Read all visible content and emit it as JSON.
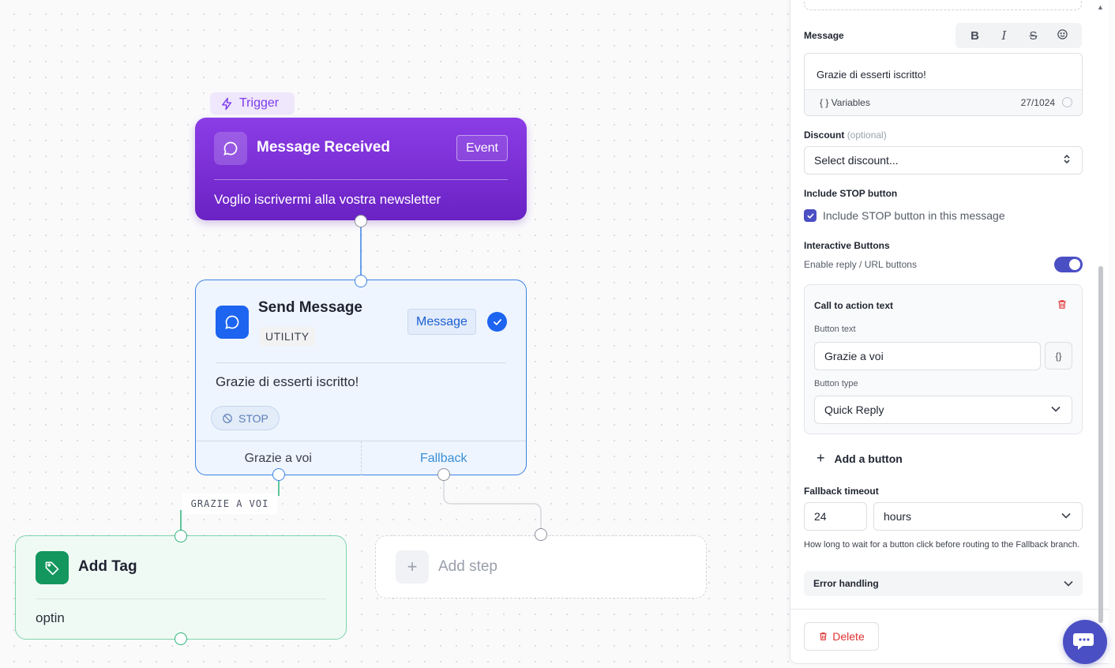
{
  "canvas": {
    "trigger_badge": "Trigger",
    "trigger_node": {
      "title": "Message Received",
      "tag": "Event",
      "body": "Voglio iscrivermi alla vostra newsletter"
    },
    "send_node": {
      "title": "Send Message",
      "category": "UTILITY",
      "tag": "Message",
      "body": "Grazie di esserti iscritto!",
      "stop_label": "STOP",
      "branches": [
        "Grazie a voi",
        "Fallback"
      ]
    },
    "edge_label": "GRAZIE A VOI",
    "tag_node": {
      "title": "Add Tag",
      "body": "optin"
    },
    "add_step": {
      "label": "Add step"
    }
  },
  "panel": {
    "message": {
      "label": "Message",
      "value": "Grazie di esserti iscritto!",
      "variables_label": "{ } Variables",
      "counter": "27/1024"
    },
    "discount": {
      "label": "Discount",
      "optional": "(optional)",
      "placeholder": "Select discount..."
    },
    "stop": {
      "label": "Include STOP button",
      "checkbox_label": "Include STOP button in this message",
      "checked": true
    },
    "interactive": {
      "label": "Interactive Buttons",
      "sub": "Enable reply / URL buttons",
      "enabled": true
    },
    "cta": {
      "title": "Call to action text",
      "button_text_label": "Button text",
      "button_text_value": "Grazie a voi",
      "var_button": "{}",
      "button_type_label": "Button type",
      "button_type_value": "Quick Reply"
    },
    "add_button": "Add a button",
    "fallback": {
      "label": "Fallback timeout",
      "value": "24",
      "unit": "hours",
      "help": "How long to wait for a button click before routing to the Fallback branch."
    },
    "error_handling": "Error handling",
    "delete": "Delete"
  },
  "colors": {
    "trigger_purple": "#7c3aed",
    "send_blue": "#1d64f0",
    "tag_green": "#13975e",
    "accent_indigo": "#4b4fc4",
    "danger": "#e03131"
  }
}
